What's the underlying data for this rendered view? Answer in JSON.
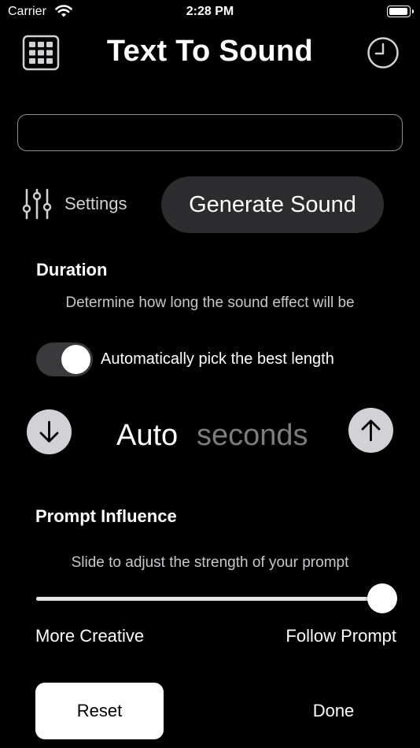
{
  "status_bar": {
    "carrier": "Carrier",
    "time": "2:28 PM",
    "battery_level": 1.0
  },
  "header": {
    "title": "Text To Sound",
    "left_icon": "grid-icon",
    "right_icon": "clock-icon"
  },
  "prompt": {
    "value": "",
    "placeholder": ""
  },
  "actions": {
    "settings_label": "Settings",
    "settings_icon": "sliders-icon",
    "generate_label": "Generate Sound"
  },
  "duration": {
    "title": "Duration",
    "description": "Determine how long the sound effect will be",
    "auto_toggle_on": true,
    "auto_toggle_label": "Automatically pick the best length",
    "value": "Auto",
    "unit": "seconds"
  },
  "prompt_influence": {
    "title": "Prompt Influence",
    "description": "Slide to adjust the strength of your prompt",
    "value": 1.0,
    "min_label": "More Creative",
    "max_label": "Follow Prompt"
  },
  "footer": {
    "reset_label": "Reset",
    "done_label": "Done"
  },
  "colors": {
    "background": "#000000",
    "surface": "#2c2c2e",
    "muted_text": "#7c7c80",
    "control_gray": "#d1d1d6"
  }
}
